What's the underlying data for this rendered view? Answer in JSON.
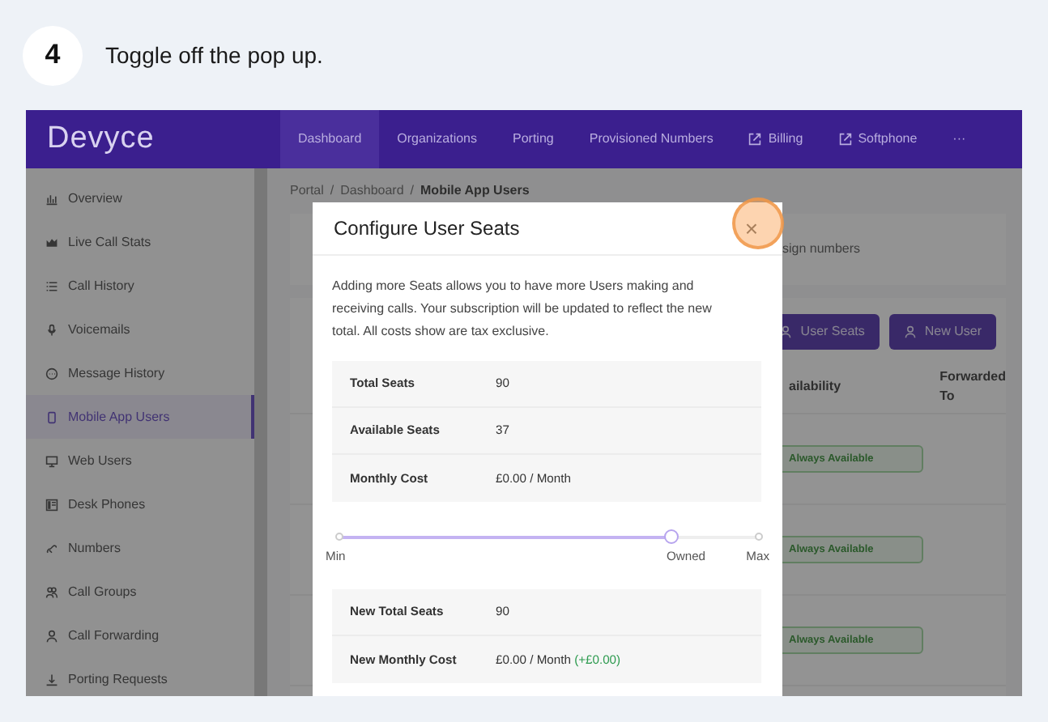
{
  "step": {
    "number": "4",
    "text": "Toggle off the pop up."
  },
  "navbar": {
    "logo": "Devyce",
    "items": [
      {
        "label": "Dashboard",
        "selected": true,
        "external": false
      },
      {
        "label": "Organizations",
        "selected": false,
        "external": false
      },
      {
        "label": "Porting",
        "selected": false,
        "external": false
      },
      {
        "label": "Provisioned Numbers",
        "selected": false,
        "external": false
      },
      {
        "label": "Billing",
        "selected": false,
        "external": true
      },
      {
        "label": "Softphone",
        "selected": false,
        "external": true
      }
    ],
    "more": "···"
  },
  "sidebar": {
    "items": [
      {
        "label": "Overview",
        "selected": false
      },
      {
        "label": "Live Call Stats",
        "selected": false
      },
      {
        "label": "Call History",
        "selected": false
      },
      {
        "label": "Voicemails",
        "selected": false
      },
      {
        "label": "Message History",
        "selected": false
      },
      {
        "label": "Mobile App Users",
        "selected": true
      },
      {
        "label": "Web Users",
        "selected": false
      },
      {
        "label": "Desk Phones",
        "selected": false
      },
      {
        "label": "Numbers",
        "selected": false
      },
      {
        "label": "Call Groups",
        "selected": false
      },
      {
        "label": "Call Forwarding",
        "selected": false
      },
      {
        "label": "Porting Requests",
        "selected": false
      }
    ]
  },
  "breadcrumb": {
    "items": [
      "Portal",
      "Dashboard",
      "Mobile App Users"
    ],
    "separator": "/"
  },
  "background": {
    "info_text": "sign numbers",
    "buttons": [
      "User Seats",
      "New User"
    ],
    "columns": [
      "ailability",
      "Forwarded To"
    ],
    "rows": [
      {
        "availability": "Always Available"
      },
      {
        "availability": "Always Available"
      },
      {
        "availability": "Always Available"
      }
    ]
  },
  "modal": {
    "title": "Configure User Seats",
    "close": "×",
    "close_highlighted": true,
    "description": "Adding more Seats allows you to have more Users making and receiving calls. Your subscription will be updated to reflect the new total. All costs show are tax exclusive.",
    "summary": [
      {
        "label": "Total Seats",
        "value": "90"
      },
      {
        "label": "Available Seats",
        "value": "37"
      },
      {
        "label": "Monthly Cost",
        "value": "£0.00 / Month"
      }
    ],
    "slider": {
      "level": 0.79,
      "labels": [
        "Min",
        "Owned",
        "Max"
      ]
    },
    "new_values": [
      {
        "label": "New Total Seats",
        "value": "90"
      },
      {
        "label": "New Monthly Cost",
        "value": "£0.00 / Month",
        "delta": "(+£0.00)"
      }
    ]
  }
}
